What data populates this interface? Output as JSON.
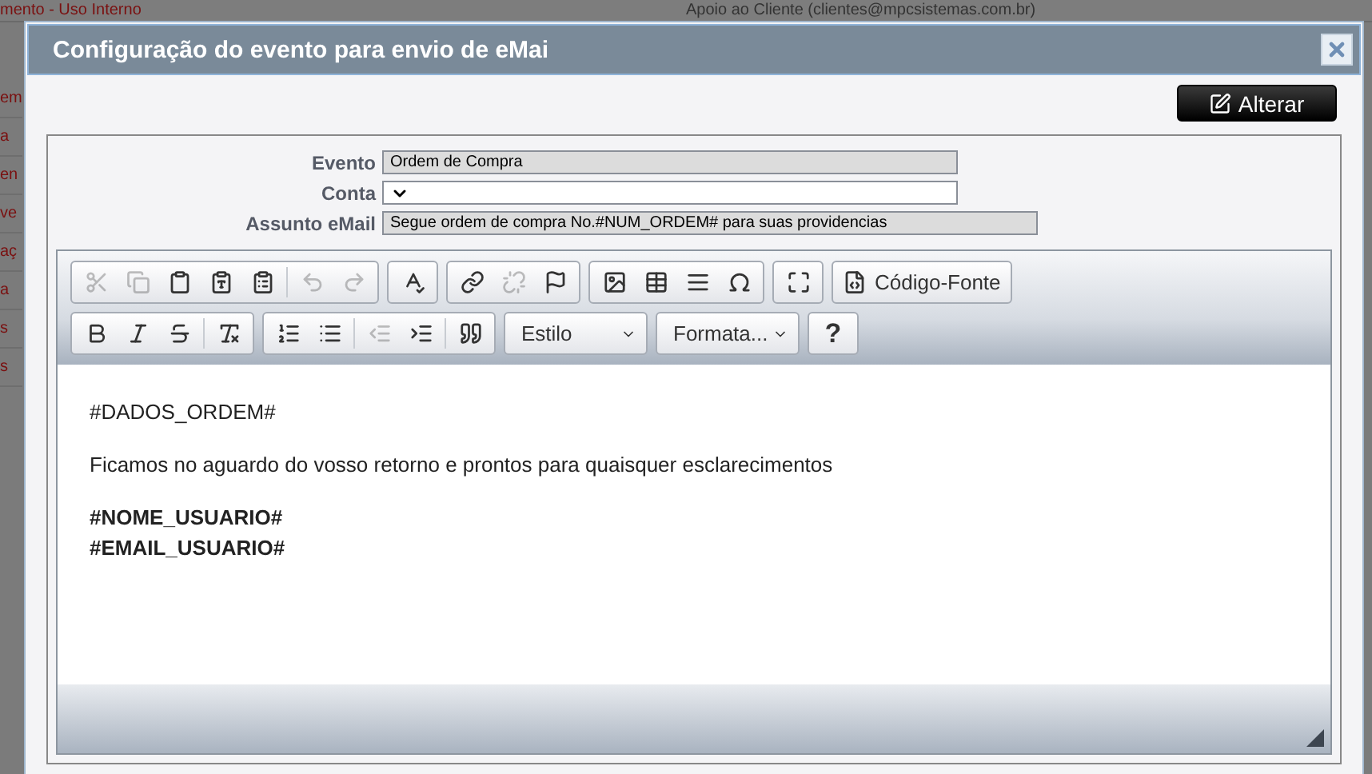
{
  "background": {
    "top_left": "mento - Uso Interno",
    "top_right": "Apoio ao Cliente (clientes@mpcsistemas.com.br)",
    "side_items": [
      "em",
      "a",
      "en",
      "ve",
      "aç",
      "a",
      "s",
      "s"
    ]
  },
  "dialog": {
    "title": "Configuração do evento para envio de eMai",
    "action_button": "Alterar"
  },
  "form": [
    {
      "label": "Evento",
      "kind": "readonly",
      "value": "Ordem de Compra",
      "wide": false
    },
    {
      "label": "Conta",
      "kind": "select",
      "wide": false
    },
    {
      "label": "Assunto eMail",
      "kind": "readonly",
      "value": "Segue ordem de compra No.#NUM_ORDEM# para suas providencias",
      "wide": true
    }
  ],
  "toolbar_rows": [
    [
      {
        "buttons": [
          {
            "kind": "cut",
            "disabled": true
          },
          {
            "kind": "copy",
            "disabled": true
          },
          {
            "kind": "paste",
            "disabled": false
          },
          {
            "kind": "paste-text",
            "disabled": false
          },
          {
            "kind": "paste-word",
            "disabled": false
          },
          {
            "kind": "sep"
          },
          {
            "kind": "undo",
            "disabled": true
          },
          {
            "kind": "redo",
            "disabled": true
          }
        ]
      },
      {
        "buttons": [
          {
            "kind": "spellcheck",
            "disabled": false
          }
        ]
      },
      {
        "buttons": [
          {
            "kind": "link",
            "disabled": false
          },
          {
            "kind": "unlink",
            "disabled": true
          },
          {
            "kind": "anchor",
            "disabled": false
          }
        ]
      },
      {
        "buttons": [
          {
            "kind": "image",
            "disabled": false
          },
          {
            "kind": "table",
            "disabled": false
          },
          {
            "kind": "hr",
            "disabled": false
          },
          {
            "kind": "omega",
            "disabled": false
          }
        ]
      },
      {
        "buttons": [
          {
            "kind": "maximize",
            "disabled": false
          }
        ]
      },
      {
        "buttons": [
          {
            "kind": "source",
            "disabled": false,
            "label": "Código-Fonte"
          }
        ]
      }
    ],
    [
      {
        "buttons": [
          {
            "kind": "bold",
            "disabled": false
          },
          {
            "kind": "italic",
            "disabled": false
          },
          {
            "kind": "strike",
            "disabled": false
          },
          {
            "kind": "sep"
          },
          {
            "kind": "clear",
            "disabled": false
          }
        ]
      },
      {
        "buttons": [
          {
            "kind": "ol",
            "disabled": false
          },
          {
            "kind": "ul",
            "disabled": false
          },
          {
            "kind": "sep"
          },
          {
            "kind": "outdent",
            "disabled": true
          },
          {
            "kind": "indent",
            "disabled": false
          },
          {
            "kind": "sep"
          },
          {
            "kind": "quote",
            "disabled": false
          }
        ]
      },
      {
        "buttons": [
          {
            "kind": "combo",
            "label": "Estilo"
          }
        ]
      },
      {
        "buttons": [
          {
            "kind": "combo",
            "label": "Formata..."
          }
        ]
      },
      {
        "buttons": [
          {
            "kind": "help",
            "label": "?",
            "disabled": false
          }
        ]
      }
    ]
  ],
  "editor_content": [
    [
      {
        "text": "#DADOS_ORDEM#",
        "bold": false
      }
    ],
    [
      {
        "text": "Ficamos no aguardo do vosso retorno e prontos para quaisquer esclarecimentos",
        "bold": false
      }
    ],
    [
      {
        "text": "#NOME_USUARIO#",
        "bold": true
      },
      {
        "text": "#EMAIL_USUARIO#",
        "bold": true
      }
    ]
  ]
}
